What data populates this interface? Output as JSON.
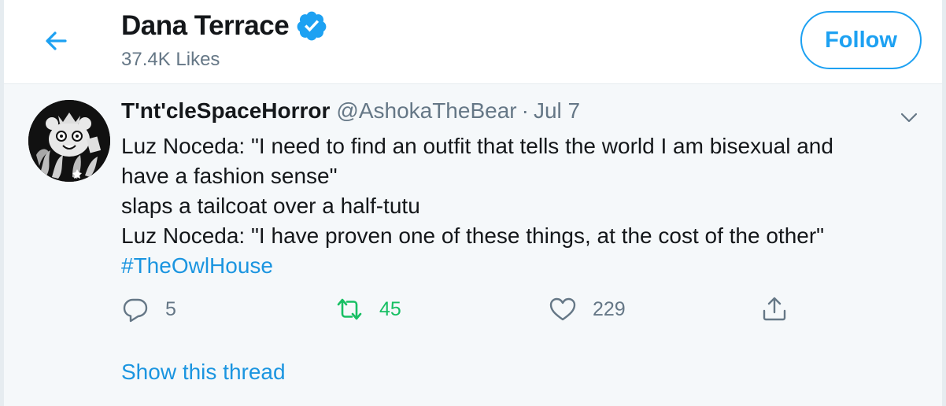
{
  "header": {
    "back_icon": "arrow-left-icon",
    "profile_name": "Dana Terrace",
    "verified_icon": "verified-badge-icon",
    "likes": "37.4K Likes",
    "follow_label": "Follow"
  },
  "tweet": {
    "avatar_icon": "avatar-image",
    "display_name": "T'nt'cleSpaceHorror",
    "handle": "@AshokaTheBear",
    "separator": "·",
    "date": "Jul 7",
    "caret_icon": "chevron-down-icon",
    "lines": [
      "Luz Noceda: \"I need to find an outfit that tells the world I am bisexual and",
      "have a fashion sense\"",
      "slaps a tailcoat over a half-tutu",
      "Luz Noceda: \"I have proven one of these things, at the cost of the other\""
    ],
    "hashtag": "#TheOwlHouse",
    "actions": {
      "reply_count": "5",
      "retweet_count": "45",
      "like_count": "229"
    },
    "show_thread": "Show this thread"
  },
  "colors": {
    "accent": "#1da1f2",
    "link": "#1b95e0",
    "retweet": "#17bf63",
    "muted": "#657786",
    "tweet_bg": "#f5f8fa"
  }
}
